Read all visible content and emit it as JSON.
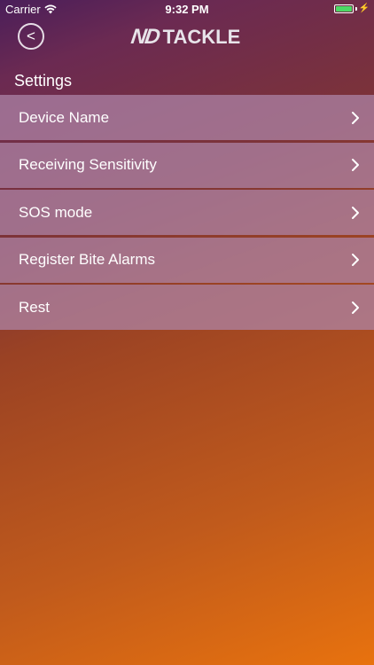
{
  "status_bar": {
    "carrier": "Carrier",
    "time": "9:32 PM",
    "battery_level": 1.0,
    "battery_color": "#4cd964"
  },
  "header": {
    "back_label": "<",
    "logo_mark": "ND",
    "logo_text": "TACKLE"
  },
  "settings": {
    "title": "Settings",
    "items": [
      {
        "label": "Device Name",
        "icon": "chevron-right-icon"
      },
      {
        "label": "Receiving Sensitivity",
        "icon": "chevron-right-icon"
      },
      {
        "label": "SOS mode",
        "icon": "chevron-right-icon"
      },
      {
        "label": "Register Bite Alarms",
        "icon": "chevron-right-icon"
      },
      {
        "label": "Rest",
        "icon": "chevron-right-icon"
      }
    ]
  }
}
